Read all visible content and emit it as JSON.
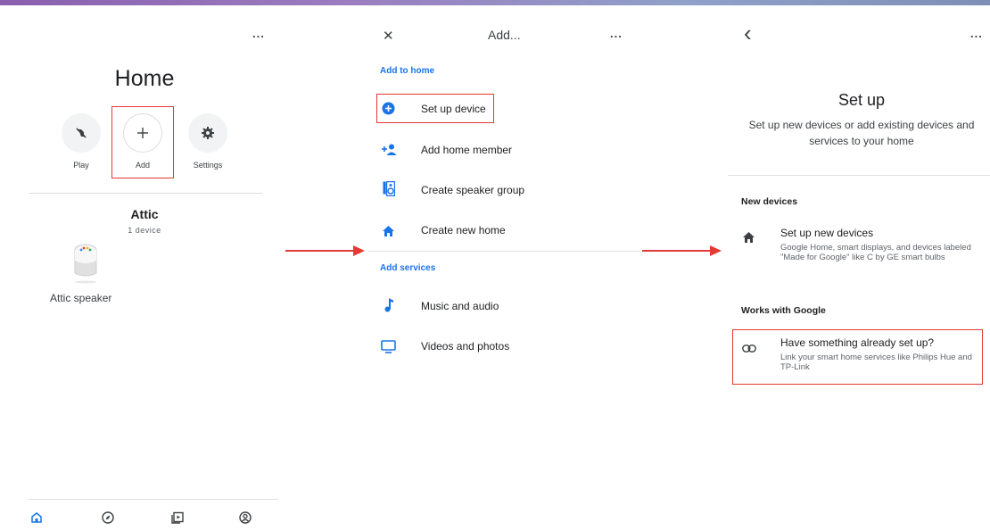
{
  "colors": {
    "accent_blue": "#1a73e8",
    "highlight_red": "#e53935",
    "arrow_red": "#e53935"
  },
  "panel1": {
    "more_label": "...",
    "title": "Home",
    "actions": [
      {
        "label": "Play",
        "icon": "speaker-mute-icon"
      },
      {
        "label": "Add",
        "icon": "plus-icon"
      },
      {
        "label": "Settings",
        "icon": "gear-icon"
      }
    ],
    "room": {
      "name": "Attic",
      "count": "1 device"
    },
    "device": {
      "label": "Attic speaker",
      "icon": "google-home-speaker-icon"
    },
    "bottom_nav": [
      "home-icon",
      "discover-compass-icon",
      "media-icon",
      "account-icon"
    ]
  },
  "panel2": {
    "close_label": "✕",
    "title": "Add...",
    "more_label": "...",
    "section_add_to_home": "Add to home",
    "items_home": [
      {
        "label": "Set up device",
        "icon": "add-circle-icon"
      },
      {
        "label": "Add home member",
        "icon": "add-person-icon"
      },
      {
        "label": "Create speaker group",
        "icon": "speaker-group-icon"
      },
      {
        "label": "Create new home",
        "icon": "home-icon"
      }
    ],
    "section_add_services": "Add services",
    "items_services": [
      {
        "label": "Music and audio",
        "icon": "music-note-icon"
      },
      {
        "label": "Videos and photos",
        "icon": "tv-icon"
      }
    ]
  },
  "panel3": {
    "back_label": "‹",
    "more_label": "...",
    "title": "Set up",
    "description": "Set up new devices or add existing devices and services to your home",
    "section_new_devices": "New devices",
    "new_device": {
      "title": "Set up new devices",
      "description": "Google Home, smart displays, and devices labeled \"Made for Google\" like C by GE smart bulbs",
      "icon": "home-icon"
    },
    "section_works_with": "Works with Google",
    "link_service": {
      "title": "Have something already set up?",
      "description": "Link your smart home services like Philips Hue and TP-Link",
      "icon": "link-icon"
    }
  }
}
